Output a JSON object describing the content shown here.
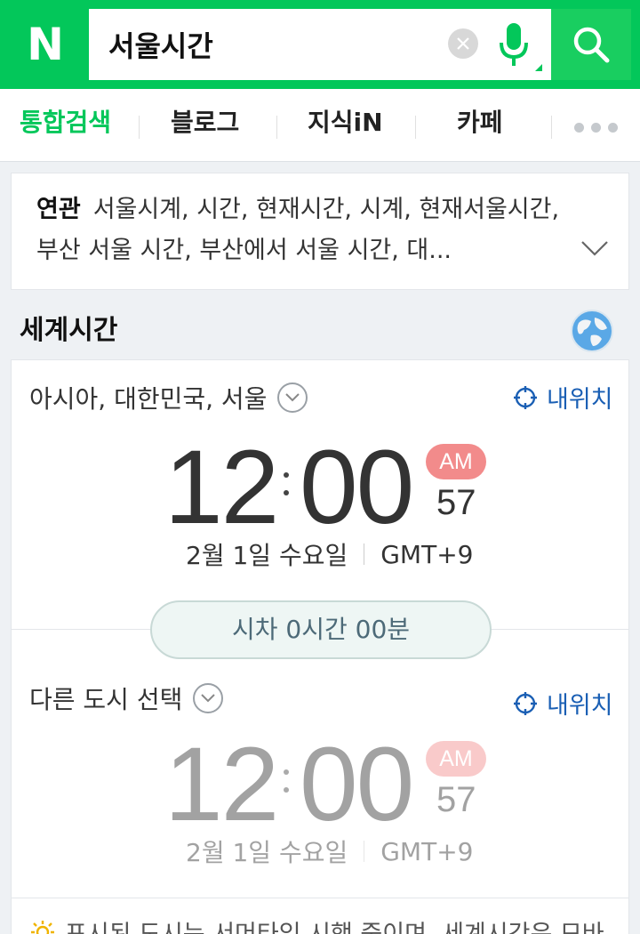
{
  "brand": {
    "logo_text": "N",
    "accent": "#03c75a"
  },
  "search": {
    "query": "서울시간",
    "placeholder": ""
  },
  "tabs": [
    {
      "label": "통합검색",
      "active": true
    },
    {
      "label": "블로그"
    },
    {
      "label": "지식iN"
    },
    {
      "label": "카페"
    }
  ],
  "related": {
    "title": "연관",
    "text": "서울시계, 시간, 현재시간, 시계, 현재서울시간, 부산 서울 시간, 부산에서 서울 시간, 대..."
  },
  "world_time": {
    "header": "세계시간",
    "primary": {
      "city": "아시아, 대한민국, 서울",
      "my_location": "내위치",
      "hours": "12",
      "minutes": "00",
      "ampm": "AM",
      "seconds": "57",
      "date": "2월 1일 수요일",
      "timezone": "GMT+9"
    },
    "time_diff": "시차 0시간 00분",
    "secondary": {
      "city": "다른 도시 선택",
      "my_location": "내위치",
      "hours": "12",
      "minutes": "00",
      "ampm": "AM",
      "seconds": "57",
      "date": "2월 1일 수요일",
      "timezone": "GMT+9"
    },
    "notice": "표시된 도시는 서머타임 시행 중이며, 세계시간은 모바"
  }
}
